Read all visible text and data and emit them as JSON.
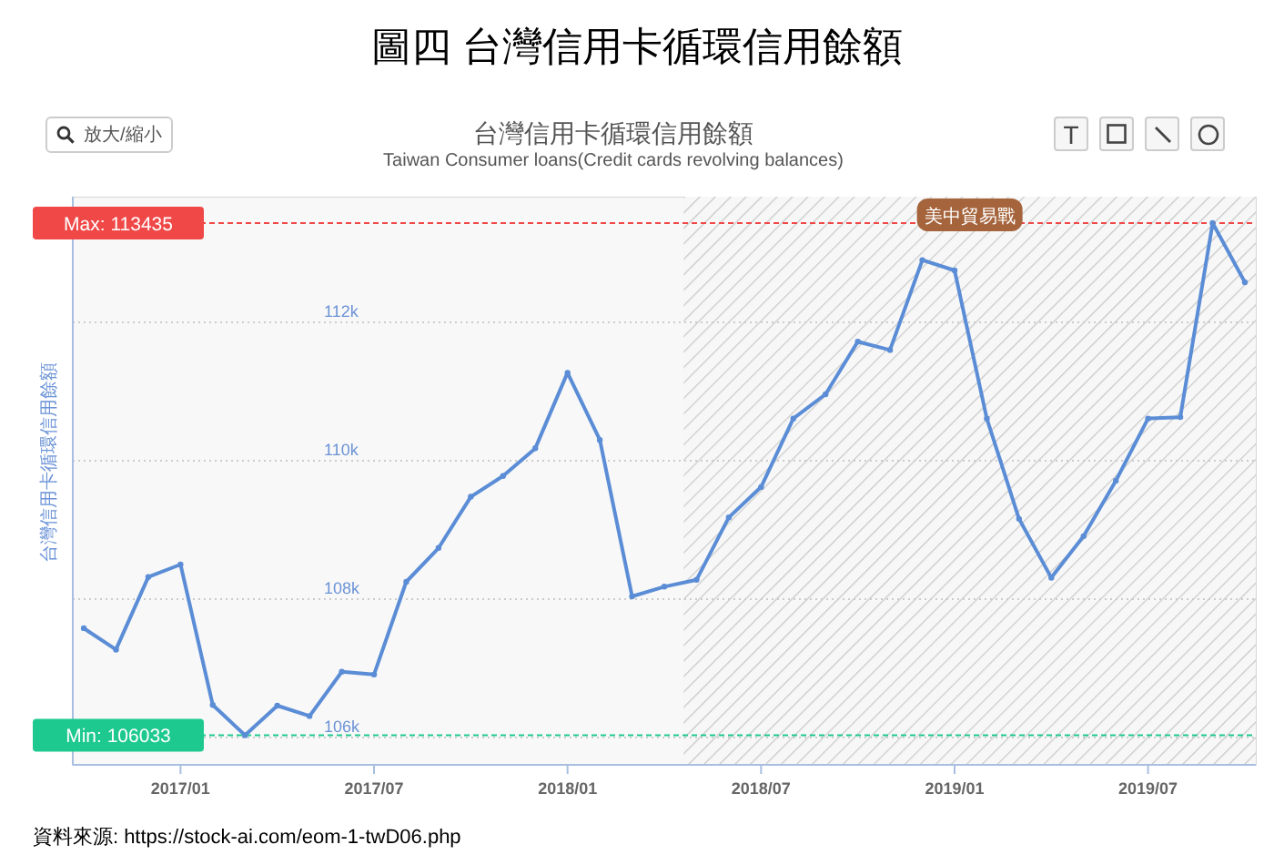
{
  "figure_title": "圖四 台灣信用卡循環信用餘額",
  "zoom_button": {
    "label": "放大/縮小"
  },
  "chart": {
    "title": "台灣信用卡循環信用餘額",
    "subtitle": "Taiwan Consumer loans(Credit cards revolving balances)",
    "chart_data": {
      "type": "line",
      "ylabel": "台灣信用卡循環信用餘額",
      "categories": [
        null,
        null,
        null,
        "2017/01",
        null,
        null,
        null,
        null,
        null,
        "2017/07",
        null,
        null,
        null,
        null,
        null,
        "2018/01",
        null,
        null,
        null,
        null,
        null,
        "2018/07",
        null,
        null,
        null,
        null,
        null,
        "2019/01",
        null,
        null,
        null,
        null,
        null,
        "2019/07",
        null,
        null,
        null
      ],
      "grid": true,
      "series": [
        {
          "color": "#5b8dd6",
          "marker": "circle",
          "values": [
            107580,
            107270,
            108320,
            108500,
            106470,
            106033,
            106460,
            106310,
            106950,
            106910,
            108250,
            108740,
            109480,
            109780,
            110180,
            111270,
            110300,
            108040,
            108180,
            108280,
            109180,
            109620,
            110610,
            110960,
            111720,
            111600,
            112900,
            112750,
            110610,
            109160,
            108310,
            108910,
            109710,
            110610,
            110630,
            113435,
            112580
          ]
        }
      ],
      "ylim": [
        105605,
        113816
      ],
      "yticks": [
        {
          "value": 106000,
          "label": "106k"
        },
        {
          "value": 108000,
          "label": "108k"
        },
        {
          "value": 110000,
          "label": "110k"
        },
        {
          "value": 112000,
          "label": "112k"
        }
      ],
      "ref_lines": [
        {
          "axis": "y",
          "value": 113435,
          "label": "Max: 113435",
          "color": "#f04747"
        },
        {
          "axis": "y",
          "value": 106033,
          "label": "Min: 106033",
          "color": "#1ec98f"
        }
      ],
      "annotations": [
        {
          "text": "美中貿易戰"
        }
      ]
    }
  },
  "tools": [
    {
      "kind": "text",
      "label": "T"
    },
    {
      "kind": "rectangle"
    },
    {
      "kind": "line"
    },
    {
      "kind": "circle"
    }
  ],
  "source": {
    "label": "資料來源:",
    "url": "https://stock-ai.com/eom-1-twD06.php"
  }
}
